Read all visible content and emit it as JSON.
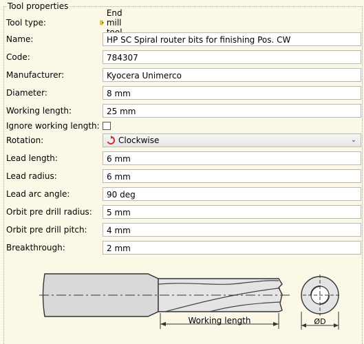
{
  "group": {
    "title": "Tool properties"
  },
  "tool_type": {
    "label": "Tool type:",
    "value": "End mill tool",
    "icon": "end-mill-icon"
  },
  "fields": {
    "name": {
      "label": "Name:",
      "value": "HP SC Spiral router bits for finishing Pos. CW"
    },
    "code": {
      "label": "Code:",
      "value": "784307"
    },
    "manufacturer": {
      "label": "Manufacturer:",
      "value": "Kyocera Unimerco"
    },
    "diameter": {
      "label": "Diameter:",
      "value": "8 mm"
    },
    "working_length": {
      "label": "Working length:",
      "value": "25 mm"
    },
    "lead_length": {
      "label": "Lead length:",
      "value": "6 mm"
    },
    "lead_radius": {
      "label": "Lead radius:",
      "value": "6 mm"
    },
    "lead_arc_angle": {
      "label": "Lead arc angle:",
      "value": "90 deg"
    },
    "orbit_pre_drill_radius": {
      "label": "Orbit pre drill radius:",
      "value": "5 mm"
    },
    "orbit_pre_drill_pitch": {
      "label": "Orbit pre drill pitch:",
      "value": "4 mm"
    },
    "breakthrough": {
      "label": "Breakthrough:",
      "value": "2 mm"
    }
  },
  "ignore_working_length": {
    "label": "Ignore working length:",
    "checked": false
  },
  "rotation": {
    "label": "Rotation:",
    "value": "Clockwise",
    "icon": "clockwise-arrow-icon",
    "accent": "#d42a2a"
  },
  "drawing": {
    "working_length_label": "Working length",
    "diameter_label": "ØD"
  }
}
